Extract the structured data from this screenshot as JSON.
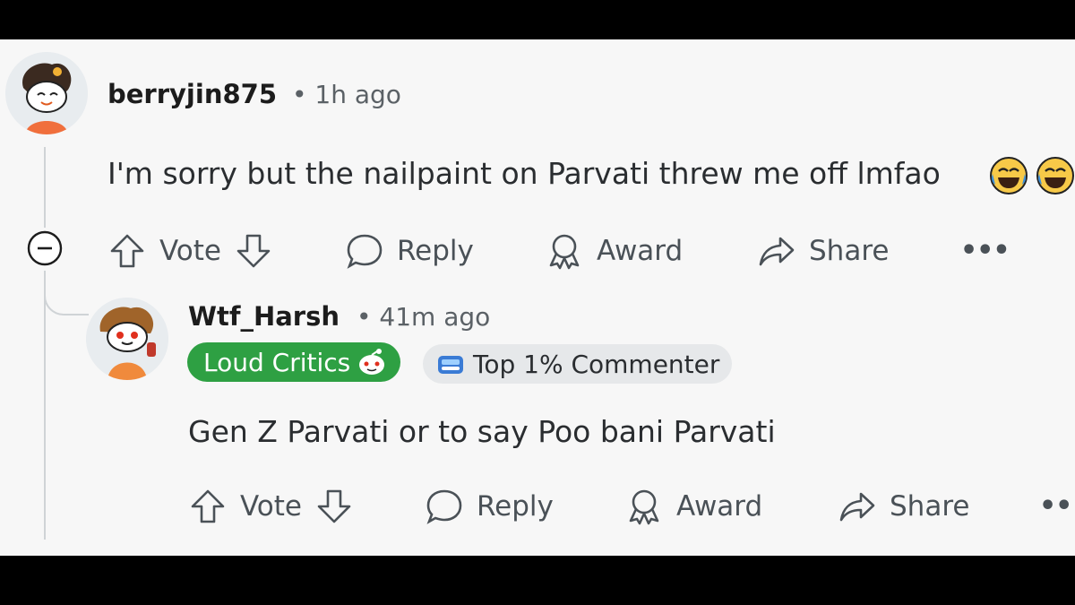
{
  "comment1": {
    "username": "berryjin875",
    "time": "• 1h ago",
    "body": "I'm sorry but the nailpaint on Parvati threw me off lmfao",
    "emoji_icons": [
      "laughing-tears-emoji",
      "laughing-tears-emoji"
    ],
    "actions": {
      "vote": "Vote",
      "reply": "Reply",
      "award": "Award",
      "share": "Share",
      "more": "•••"
    }
  },
  "comment2": {
    "username": "Wtf_Harsh",
    "time": "• 41m ago",
    "flair": "Loud Critics",
    "achievement": "Top 1% Commenter",
    "body": "Gen Z Parvati or to say Poo bani Parvati",
    "actions": {
      "vote": "Vote",
      "reply": "Reply",
      "award": "Award",
      "share": "Share",
      "more": "•••"
    }
  },
  "colors": {
    "flair_bg": "#2ea043",
    "achievement_bg": "#e6e8ea",
    "background": "#f7f7f7"
  }
}
